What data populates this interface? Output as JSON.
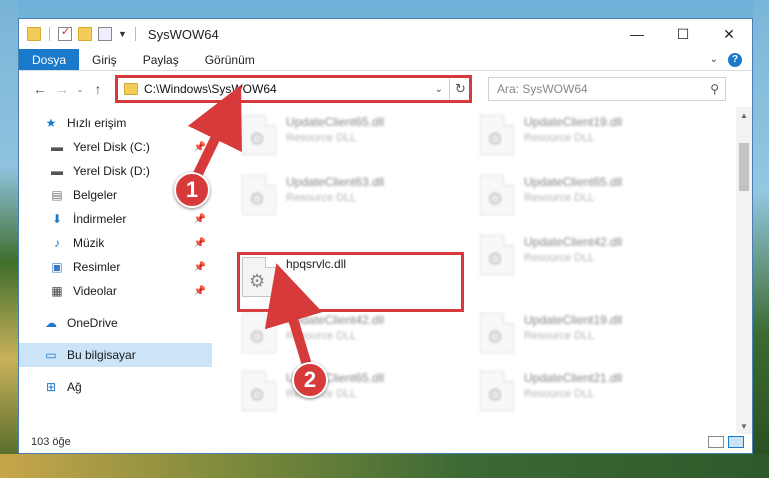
{
  "window": {
    "title": "SysWOW64"
  },
  "window_controls": {
    "minimize": "—",
    "maximize": "☐",
    "close": "✕"
  },
  "ribbon": {
    "tabs": [
      "Dosya",
      "Giriş",
      "Paylaş",
      "Görünüm"
    ],
    "active_tab": "Dosya",
    "help": "?"
  },
  "address_bar": {
    "path": "C:\\Windows\\SysWOW64",
    "search_placeholder": "Ara: SysWOW64"
  },
  "nav_pane": {
    "items": [
      {
        "label": "Hızlı erişim",
        "icon": "star-icon",
        "pinned": false
      },
      {
        "label": "Yerel Disk (C:)",
        "icon": "drive-icon",
        "pinned": true
      },
      {
        "label": "Yerel Disk (D:)",
        "icon": "drive-icon",
        "pinned": true
      },
      {
        "label": "Belgeler",
        "icon": "documents-icon",
        "pinned": true
      },
      {
        "label": "İndirmeler",
        "icon": "download-icon",
        "pinned": true
      },
      {
        "label": "Müzik",
        "icon": "music-icon",
        "pinned": true
      },
      {
        "label": "Resimler",
        "icon": "pictures-icon",
        "pinned": true
      },
      {
        "label": "Videolar",
        "icon": "videos-icon",
        "pinned": true
      },
      {
        "label": "OneDrive",
        "icon": "cloud-icon",
        "pinned": false
      },
      {
        "label": "Bu bilgisayar",
        "icon": "computer-icon",
        "pinned": false,
        "selected": true
      },
      {
        "label": "Ağ",
        "icon": "network-icon",
        "pinned": false
      }
    ]
  },
  "files": [
    {
      "name": "UpdateClient65.dll",
      "type": "Resource DLL",
      "blurred": true
    },
    {
      "name": "UpdateClient19.dll",
      "type": "Resource DLL",
      "blurred": true
    },
    {
      "name": "UpdateClient63.dll",
      "type": "Resource DLL",
      "blurred": true
    },
    {
      "name": "UpdateClient65.dll",
      "type": "Resource DLL",
      "blurred": true
    },
    {
      "name": "hpqsrvlc.dll",
      "type": "",
      "blurred": false,
      "highlighted": true
    },
    {
      "name": "UpdateClient42.dll",
      "type": "Resource DLL",
      "blurred": true
    },
    {
      "name": "UpdateClient42.dll",
      "type": "Resource DLL",
      "blurred": true
    },
    {
      "name": "UpdateClient19.dll",
      "type": "Resource DLL",
      "blurred": true
    },
    {
      "name": "UpdateClient65.dll",
      "type": "Resource DLL",
      "blurred": true
    },
    {
      "name": "UpdateClient21.dll",
      "type": "Resource DLL",
      "blurred": true
    }
  ],
  "status": {
    "item_count": "103 öğe"
  },
  "annotations": {
    "step1": "1",
    "step2": "2",
    "accent_color": "#d73a3a"
  }
}
